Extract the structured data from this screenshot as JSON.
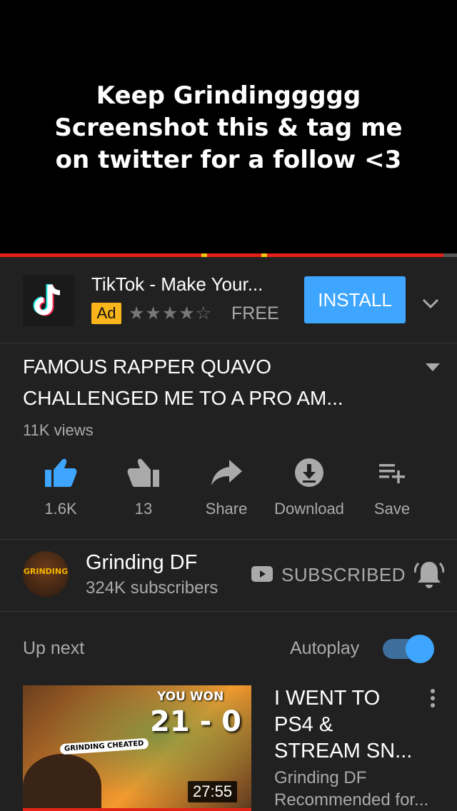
{
  "player": {
    "caption_lines": [
      "Keep Grindinggggg",
      "Screenshot this & tag me",
      "on twitter for a follow <3"
    ],
    "progress": 0.97
  },
  "ad": {
    "title": "TikTok - Make Your...",
    "badge": "Ad",
    "rating": 4.5,
    "stars": "★★★★☆",
    "price": "FREE",
    "install_label": "INSTALL",
    "install_color": "#3ea6ff"
  },
  "video": {
    "title": "FAMOUS RAPPER QUAVO CHALLENGED ME TO A PRO AM...",
    "views": "11K views"
  },
  "actions": {
    "like_count": "1.6K",
    "dislike_count": "13",
    "share_label": "Share",
    "download_label": "Download",
    "save_label": "Save"
  },
  "channel": {
    "name": "Grinding DF",
    "subscribers": "324K subscribers",
    "subscribed_label": "SUBSCRIBED",
    "avatar_text": "GRINDING"
  },
  "upnext": {
    "heading": "Up next",
    "autoplay_label": "Autoplay",
    "autoplay_on": true
  },
  "recommendation": {
    "title": "I WENT TO PS4 & STREAM SN...",
    "channel": "Grinding DF",
    "meta": "Recommended for...",
    "duration": "27:55",
    "thumb_won": "YOU WON",
    "thumb_score": "21 - 0",
    "thumb_tag": "GRINDING CHEATED"
  },
  "colors": {
    "accent": "#3ea6ff",
    "youtube_red": "#e62117",
    "ad_badge": "#f9b51b",
    "background": "#212121"
  }
}
